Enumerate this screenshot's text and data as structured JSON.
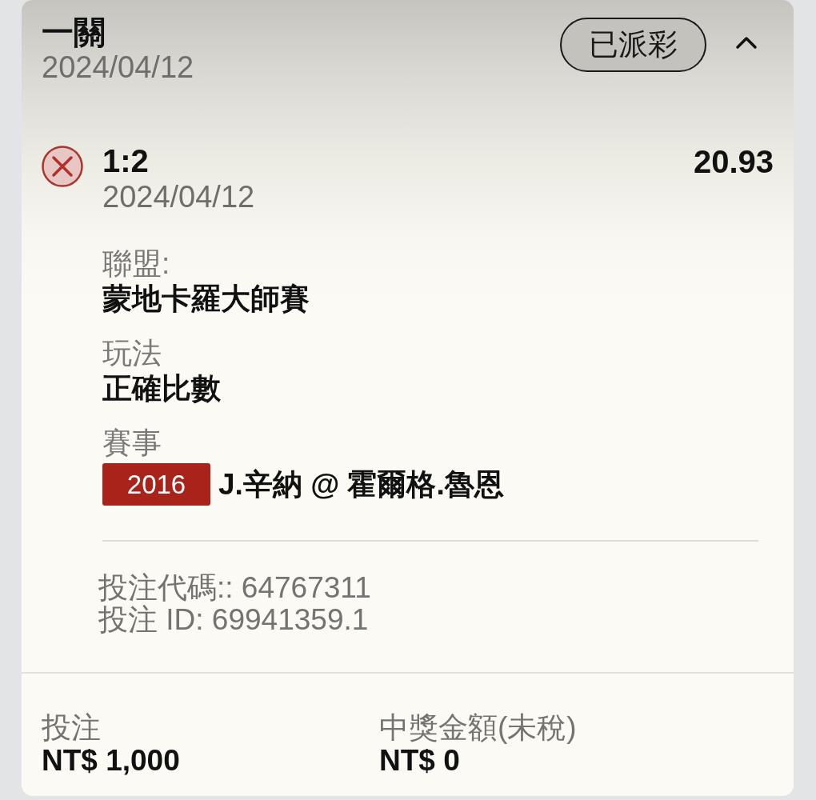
{
  "bet": {
    "title": "一關",
    "date": "2024/04/12",
    "status": "已派彩",
    "expanded": true
  },
  "selections": [
    {
      "won": false,
      "pick": "1:2",
      "date": "2024/04/12",
      "odds": "20.93",
      "details": [
        {
          "label": "聯盟:",
          "value": "蒙地卡羅大師賽"
        },
        {
          "label": "玩法",
          "value": "正確比數"
        },
        {
          "label": "賽事",
          "event_code": "2016",
          "value": "J.辛納 @ 霍爾格.魯恩"
        }
      ],
      "codes": [
        "投注代碼:: 64767311",
        "投注 ID: 69941359.1"
      ]
    }
  ],
  "summary": [
    {
      "label": "投注",
      "value": "NT$ 1,000"
    },
    {
      "label": "中獎金額(未稅)",
      "value": "NT$ 0"
    }
  ]
}
